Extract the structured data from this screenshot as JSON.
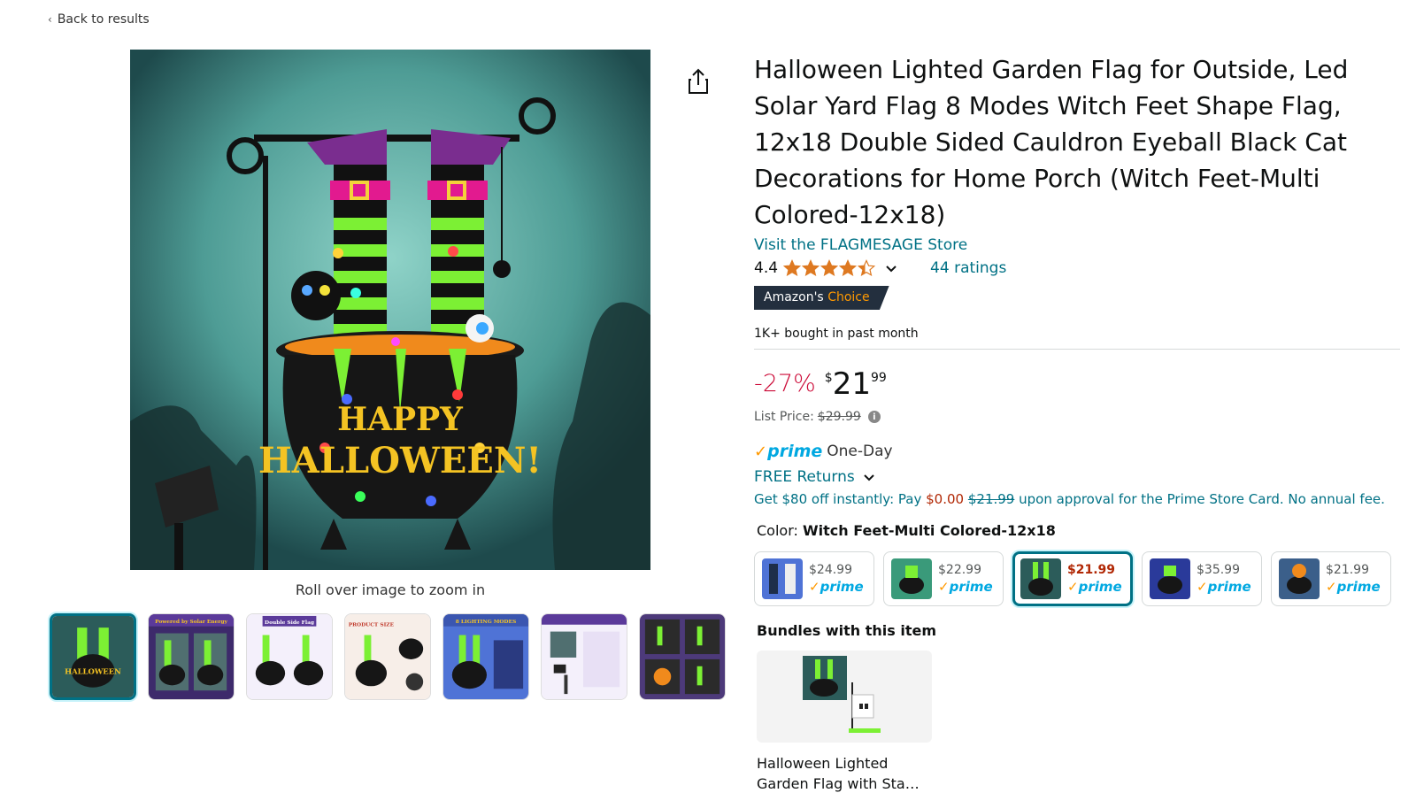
{
  "nav": {
    "back_label": "Back to results"
  },
  "gallery": {
    "zoom_hint": "Roll over image to zoom in",
    "main_image_text": {
      "line1": "HAPPY",
      "line2": "HALLOWEEN!"
    },
    "thumbnails": [
      {
        "caption": ""
      },
      {
        "caption": "Powered by Solar Energy"
      },
      {
        "caption": "Double Side Flag"
      },
      {
        "caption": "PRODUCT SIZE"
      },
      {
        "caption": "8 LIGHTING MODES"
      },
      {
        "caption": ""
      },
      {
        "caption": ""
      }
    ]
  },
  "product": {
    "title": "Halloween Lighted Garden Flag for Outside, Led Solar Yard Flag 8 Modes Witch Feet Shape Flag, 12x18 Double Sided Cauldron Eyeball Black Cat Decorations for Home Porch (Witch Feet-Multi Colored-12x18)",
    "store_link": "Visit the FLAGMESAGE Store",
    "rating_value": "4.4",
    "rating_stars": 4.4,
    "ratings_count": "44 ratings",
    "badge_prefix": "Amazon's ",
    "badge_choice": "Choice",
    "bought_text": "1K+ bought in past month"
  },
  "pricing": {
    "discount": "-27%",
    "currency": "$",
    "whole": "21",
    "fraction": "99",
    "list_price_label": "List Price:",
    "list_price_value": "$29.99"
  },
  "delivery": {
    "prime_check": "✓",
    "prime_word": "prime",
    "prime_speed": "One-Day",
    "returns_label": "FREE Returns"
  },
  "offer": {
    "part1": "Get $80 off instantly: Pay ",
    "pay_amount": "$0.00",
    "space": " ",
    "original_amount": "$21.99",
    "part2": " upon approval for the Prime Store Card. No annual fee."
  },
  "color": {
    "label": "Color:",
    "selected": "Witch Feet-Multi Colored-12x18",
    "options": [
      {
        "price": "$24.99",
        "prime": "prime"
      },
      {
        "price": "$22.99",
        "prime": "prime"
      },
      {
        "price": "$21.99",
        "prime": "prime"
      },
      {
        "price": "$35.99",
        "prime": "prime"
      },
      {
        "price": "$21.99",
        "prime": "prime"
      }
    ]
  },
  "bundles": {
    "title": "Bundles with this item",
    "item_name": "Halloween Lighted Garden Flag with Sta…"
  },
  "colors": {
    "link": "#007185",
    "deal_red": "#cc0c39",
    "badge_bg": "#232f3e",
    "badge_accent": "#ff9900",
    "prime_blue": "#00a8e1",
    "star": "#de7921"
  }
}
